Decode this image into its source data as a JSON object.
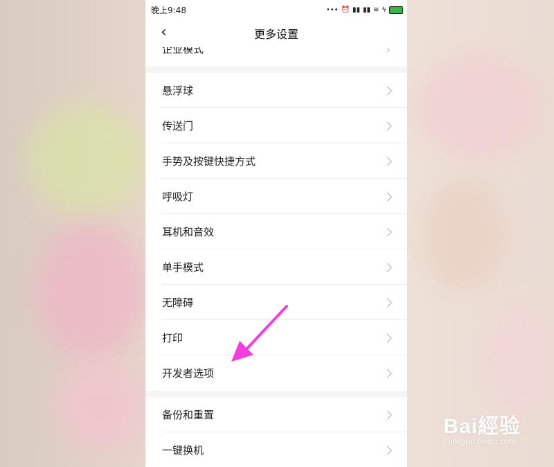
{
  "status": {
    "time": "晚上9:48",
    "icons": [
      "more-icon",
      "alarm-icon",
      "signal-icon",
      "signal-icon",
      "wifi-icon",
      "charging-icon",
      "battery-icon"
    ]
  },
  "header": {
    "title": "更多设置",
    "back_icon": "chevron-left-icon"
  },
  "partial_item": "企业模式",
  "groups": [
    {
      "items": [
        {
          "label": "悬浮球"
        },
        {
          "label": "传送门"
        },
        {
          "label": "手势及按键快捷方式"
        },
        {
          "label": "呼吸灯"
        },
        {
          "label": "耳机和音效"
        },
        {
          "label": "单手模式"
        },
        {
          "label": "无障碍"
        },
        {
          "label": "打印"
        },
        {
          "label": "开发者选项"
        }
      ]
    },
    {
      "items": [
        {
          "label": "备份和重置"
        },
        {
          "label": "一键换机"
        }
      ]
    }
  ],
  "annotation": {
    "color": "#f23ee0"
  },
  "watermark": {
    "main": "Bai經验",
    "sub": "jingyan.baidu.com"
  }
}
